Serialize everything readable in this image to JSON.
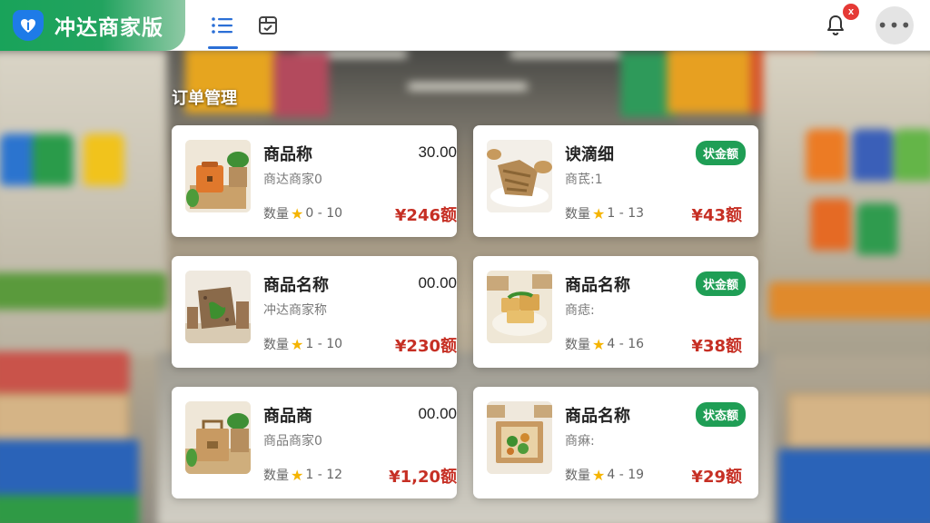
{
  "app": {
    "title": "冲达商家版",
    "section_title": "订单管理"
  },
  "icons": {
    "brand": "shield-heart-icon",
    "nav_list": "list-icon",
    "nav_box": "package-box-icon",
    "bell": "bell-icon",
    "more": "more-dots-icon"
  },
  "notifications": {
    "badge": "x"
  },
  "colors": {
    "brand_green": "#22a35f",
    "accent_blue": "#2b6fd6",
    "price_red": "#c62f24",
    "badge_green": "#1f9e55"
  },
  "orders": [
    {
      "name": "商品称",
      "shop": "商达商家0",
      "qty_label": "数量",
      "qty_range": "0 - 10",
      "price_top": "30.00",
      "amount": "¥246额",
      "badge": ""
    },
    {
      "name": "谀滴细",
      "shop": "商茋:1",
      "qty_label": "数量",
      "qty_range": "1 - 13",
      "price_top": "",
      "amount": "¥43额",
      "badge": "状金额"
    },
    {
      "name": "商品名称",
      "shop": "冲达商家称",
      "qty_label": "数量",
      "qty_range": "1 - 10",
      "price_top": "00.00",
      "amount": "¥230额",
      "badge": ""
    },
    {
      "name": "商品名称",
      "shop": "商痣:",
      "qty_label": "数量",
      "qty_range": "4 - 16",
      "price_top": "",
      "amount": "¥38额",
      "badge": "状金额"
    },
    {
      "name": "商品商",
      "shop": "商品商家0",
      "qty_label": "数量",
      "qty_range": "1 - 12",
      "price_top": "00.00",
      "amount": "¥1,20额",
      "badge": ""
    },
    {
      "name": "商品名称",
      "shop": "商痳:",
      "qty_label": "数量",
      "qty_range": "4 - 19",
      "price_top": "",
      "amount": "¥29额",
      "badge": "状态额"
    }
  ]
}
